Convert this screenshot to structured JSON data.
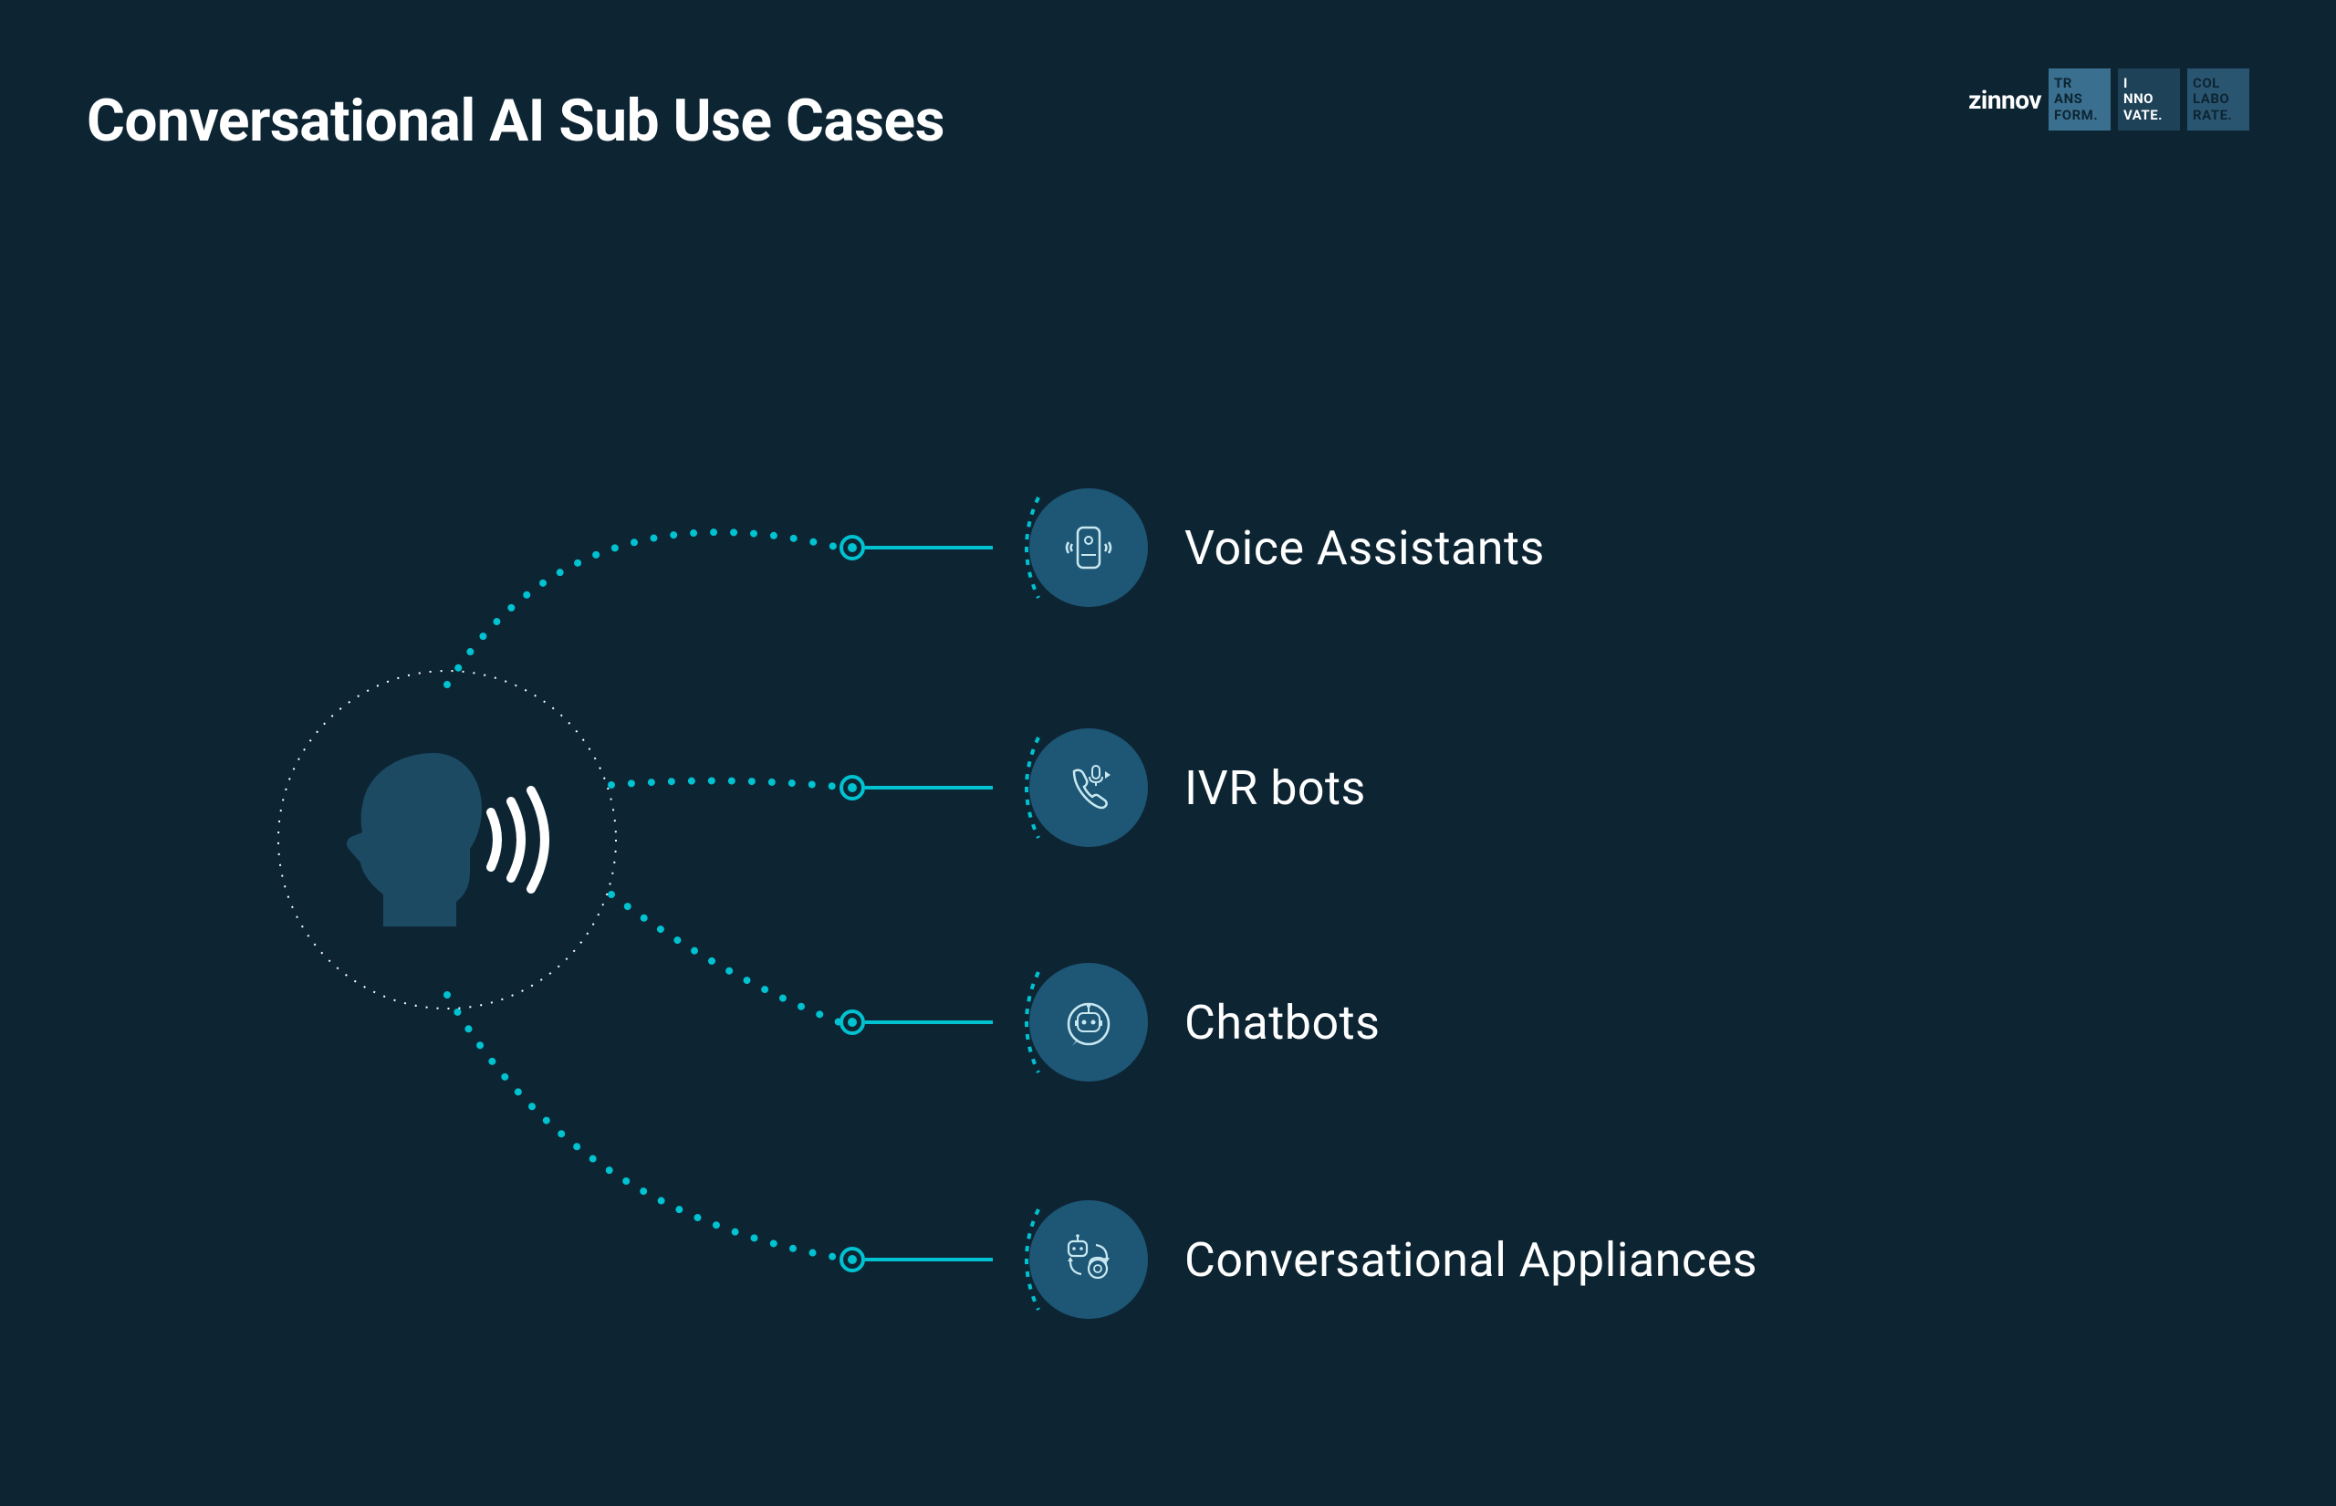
{
  "title": "Conversational AI Sub Use Cases",
  "logo": {
    "brand": "zinnov",
    "badges": [
      {
        "l1": "TR",
        "l2": "ANS",
        "l3": "FORM."
      },
      {
        "l1": "I",
        "l2": "NNO",
        "l3": "VATE."
      },
      {
        "l1": "COL",
        "l2": "LABO",
        "l3": "RATE."
      }
    ]
  },
  "items": [
    {
      "label": "Voice Assistants",
      "icon": "voice-assistant-icon"
    },
    {
      "label": "IVR bots",
      "icon": "ivr-phone-icon"
    },
    {
      "label": "Chatbots",
      "icon": "chatbot-icon"
    },
    {
      "label": "Conversational Appliances",
      "icon": "conversational-appliance-icon"
    }
  ],
  "colors": {
    "background": "#0d2533",
    "accent": "#00c2d1",
    "circle": "#1e5676",
    "central_head": "#1d4a63"
  }
}
